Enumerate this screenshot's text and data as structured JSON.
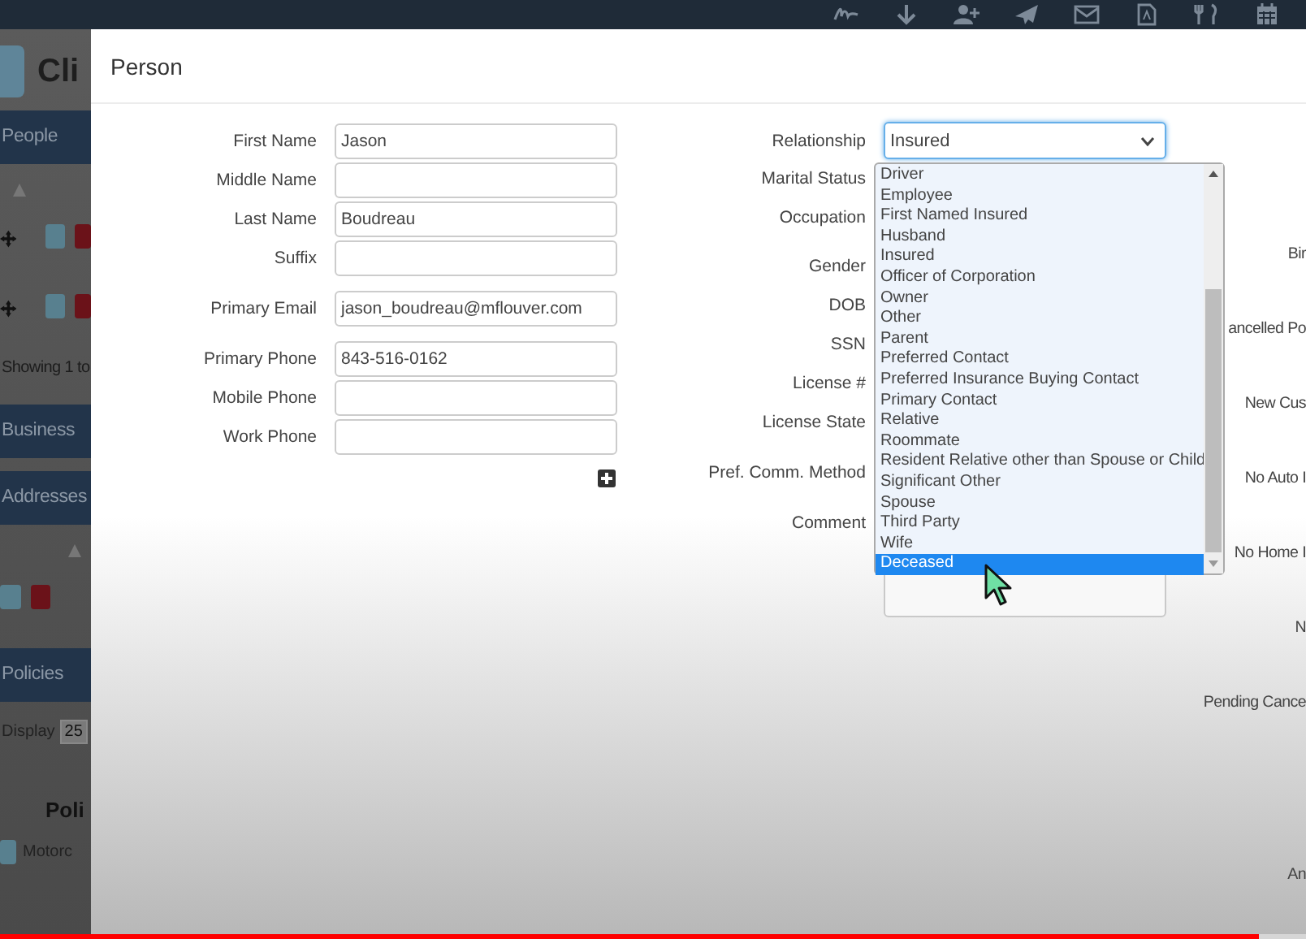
{
  "background_page": [
    {
      "kind": "heading",
      "text": "Cli"
    },
    {
      "kind": "section",
      "text": "People"
    },
    {
      "kind": "sort"
    },
    {
      "kind": "move_actions"
    },
    {
      "kind": "move_actions"
    },
    {
      "kind": "info",
      "text": "Showing 1 to"
    },
    {
      "kind": "section",
      "text": "Business"
    },
    {
      "kind": "section",
      "text": "Addresses"
    },
    {
      "kind": "sort"
    },
    {
      "kind": "actions"
    },
    {
      "kind": "section",
      "text": "Policies"
    },
    {
      "kind": "display",
      "label": "Display",
      "value": "25"
    },
    {
      "kind": "column_heading",
      "text": "Poli"
    },
    {
      "kind": "policy_row",
      "text": "Motorc"
    }
  ],
  "modal": {
    "title": "Person",
    "left_groups": [
      [
        {
          "label": "First Name",
          "value": "Jason"
        },
        {
          "label": "Middle Name"
        },
        {
          "label": "Last Name",
          "value": "Boudreau"
        },
        {
          "label": "Suffix"
        }
      ],
      [
        {
          "label": "Primary Email",
          "value": "jason_boudreau@mflouver.com"
        }
      ],
      [
        {
          "label": "Primary Phone",
          "value": "843-516-0162"
        },
        {
          "label": "Mobile Phone"
        },
        {
          "label": "Work Phone"
        }
      ]
    ],
    "middle_fields": [
      {
        "label": "Relationship",
        "kind": "select",
        "value": "Insured"
      },
      {
        "label": "Marital Status",
        "kind": "label"
      },
      {
        "label": "Occupation",
        "kind": "label"
      },
      {
        "label": "Gender",
        "kind": "label"
      },
      {
        "label": "DOB",
        "kind": "label"
      },
      {
        "label": "SSN",
        "kind": "label"
      },
      {
        "label": "License #",
        "kind": "label"
      },
      {
        "label": "License State",
        "kind": "label"
      },
      {
        "label": "Pref. Comm. Method",
        "kind": "label"
      },
      {
        "label": "Comment",
        "kind": "textarea"
      }
    ],
    "right_labels": [
      "Bir",
      "ancelled Po",
      "New Cus",
      "No Auto I",
      "No Home I",
      "N",
      "Pending Cance",
      "An"
    ],
    "dropdown": [
      {
        "label": "Driver",
        "selected": false
      },
      {
        "label": "Employee",
        "selected": false
      },
      {
        "label": "First Named Insured",
        "selected": false
      },
      {
        "label": "Husband",
        "selected": false
      },
      {
        "label": "Insured",
        "selected": false
      },
      {
        "label": "Officer of Corporation",
        "selected": false
      },
      {
        "label": "Owner",
        "selected": false
      },
      {
        "label": "Other",
        "selected": false
      },
      {
        "label": "Parent",
        "selected": false
      },
      {
        "label": "Preferred Contact",
        "selected": false
      },
      {
        "label": "Preferred Insurance Buying Contact",
        "selected": false
      },
      {
        "label": "Primary Contact",
        "selected": false
      },
      {
        "label": "Relative",
        "selected": false
      },
      {
        "label": "Roommate",
        "selected": false
      },
      {
        "label": "Resident Relative other than Spouse or Child",
        "selected": false
      },
      {
        "label": "Significant Other",
        "selected": false
      },
      {
        "label": "Spouse",
        "selected": false
      },
      {
        "label": "Third Party",
        "selected": false
      },
      {
        "label": "Wife",
        "selected": false
      },
      {
        "label": "Deceased",
        "selected": true
      }
    ]
  },
  "video_progress": {
    "level": 0.964
  }
}
